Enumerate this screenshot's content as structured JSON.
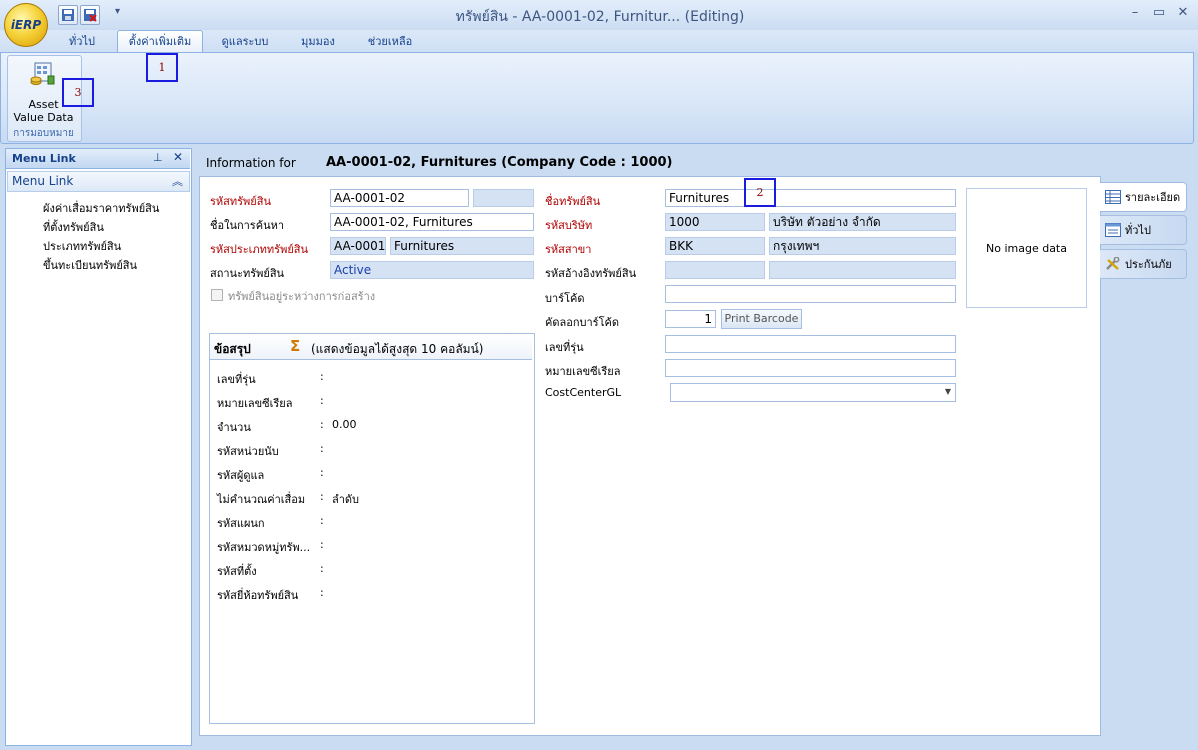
{
  "window": {
    "title": "ทรัพย์สิน - AA-0001-02, Furnitur... (Editing)",
    "app_logo": "iERP",
    "minimize": "–",
    "restore": "▭",
    "close": "✕",
    "qat_dropdown": "▾"
  },
  "ribbon": {
    "tabs": [
      "ทั่วไป",
      "ตั้งค่าเพิ่มเติม",
      "ดูแลระบบ",
      "มุมมอง",
      "ช่วยเหลือ"
    ],
    "active_tab_index": 1,
    "group_label": "การมอบหมาย",
    "asset_value_button": "Asset\nValue Data"
  },
  "annotations": [
    "1",
    "2",
    "3"
  ],
  "menu_link": {
    "title": "Menu Link",
    "group": "Menu Link",
    "items": [
      "ผังค่าเสื่อมราคาทรัพย์สิน",
      "ที่ตั้งทรัพย์สิน",
      "ประเภททรัพย์สิน",
      "ขึ้นทะเบียนทรัพย์สิน"
    ]
  },
  "info": {
    "label": "Information for",
    "value": "AA-0001-02, Furnitures (Company Code : 1000)"
  },
  "form": {
    "asset_code_label": "รหัสทรัพย์สิน",
    "asset_code": "AA-0001-02",
    "search_name_label": "ชื่อในการค้นหา",
    "search_name": "AA-0001-02, Furnitures",
    "asset_type_label": "รหัสประเภททรัพย์สิน",
    "asset_type_code": "AA-0001",
    "asset_type_name": "Furnitures",
    "status_label": "สถานะทรัพย์สิน",
    "status": "Active",
    "under_construction_label": "ทรัพย์สินอยู่ระหว่างการก่อสร้าง",
    "asset_name_label": "ชื่อทรัพย์สิน",
    "asset_name": "Furnitures",
    "company_label": "รหัสบริษัท",
    "company_code": "1000",
    "company_name": "บริษัท ตัวอย่าง จำกัด",
    "branch_label": "รหัสสาขา",
    "branch_code": "BKK",
    "branch_name": "กรุงเทพฯ",
    "ref_asset_label": "รหัสอ้างอิงทรัพย์สิน",
    "barcode_label": "บาร์โค้ด",
    "copy_barcode_label": "คัดลอกบาร์โค้ด",
    "copy_barcode_qty": "1",
    "print_barcode": "Print Barcode",
    "model_label": "เลขที่รุ่น",
    "serial_label": "หมายเลขซีเรียล",
    "costcenter_label": "CostCenterGL",
    "no_image": "No image data"
  },
  "summary": {
    "title": "ข้อสรุป",
    "note": "(แสดงข้อมูลได้สูงสุด 10 คอลัมน์)",
    "rows": [
      {
        "label": "เลขที่รุ่น",
        "value": ""
      },
      {
        "label": "หมายเลขซีเรียล",
        "value": ""
      },
      {
        "label": "จำนวน",
        "value": "0.00"
      },
      {
        "label": "รหัสหน่วยนับ",
        "value": ""
      },
      {
        "label": "รหัสผู้ดูแล",
        "value": ""
      },
      {
        "label": "ไม่คำนวณค่าเสื่อม",
        "value": "ลำดับ"
      },
      {
        "label": "รหัสแผนก",
        "value": ""
      },
      {
        "label": "รหัสหมวดหมู่ทรัพ...",
        "value": ""
      },
      {
        "label": "รหัสที่ตั้ง",
        "value": ""
      },
      {
        "label": "รหัสยี่ห้อทรัพย์สิน",
        "value": ""
      }
    ]
  },
  "side_tabs": [
    "รายละเอียด",
    "ทั่วไป",
    "ประกันภัย"
  ]
}
